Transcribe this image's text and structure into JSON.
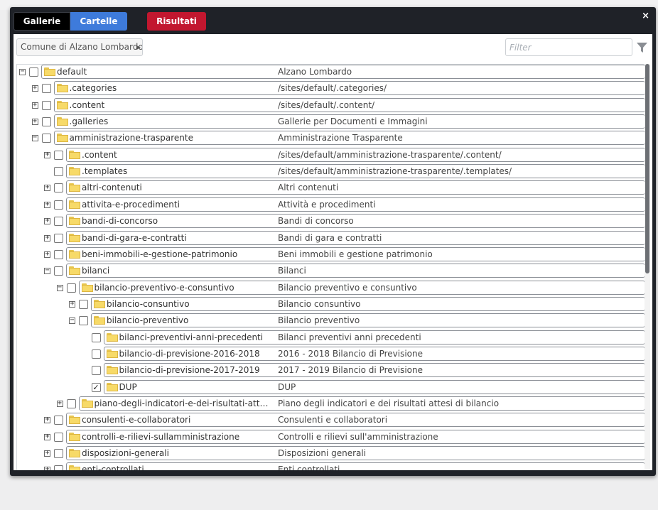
{
  "tabs": {
    "gallerie": "Gallerie",
    "cartelle": "Cartelle",
    "risultati": "Risultati"
  },
  "close_glyph": "×",
  "toolbar": {
    "site_select": "Comune di Alzano Lombardo",
    "filter_placeholder": "Filter",
    "filter_icon": "funnel-icon"
  },
  "colors": {
    "tab_active": "#3e7bdb",
    "tab_results": "#c2172f",
    "folder": "#f7da68"
  },
  "tree": [
    {
      "name": "default",
      "desc": "Alzano Lombardo",
      "level": 0,
      "expander": "minus",
      "checked": false
    },
    {
      "name": ".categories",
      "desc": "/sites/default/.categories/",
      "level": 1,
      "expander": "plus",
      "checked": false
    },
    {
      "name": ".content",
      "desc": "/sites/default/.content/",
      "level": 1,
      "expander": "plus",
      "checked": false
    },
    {
      "name": ".galleries",
      "desc": "Gallerie per Documenti e Immagini",
      "level": 1,
      "expander": "plus",
      "checked": false
    },
    {
      "name": "amministrazione-trasparente",
      "desc": "Amministrazione Trasparente",
      "level": 1,
      "expander": "minus",
      "checked": false
    },
    {
      "name": ".content",
      "desc": "/sites/default/amministrazione-trasparente/.content/",
      "level": 2,
      "expander": "plus",
      "checked": false
    },
    {
      "name": ".templates",
      "desc": "/sites/default/amministrazione-trasparente/.templates/",
      "level": 2,
      "expander": "none",
      "checked": false
    },
    {
      "name": "altri-contenuti",
      "desc": "Altri contenuti",
      "level": 2,
      "expander": "plus",
      "checked": false
    },
    {
      "name": "attivita-e-procedimenti",
      "desc": "Attività e procedimenti",
      "level": 2,
      "expander": "plus",
      "checked": false
    },
    {
      "name": "bandi-di-concorso",
      "desc": "Bandi di concorso",
      "level": 2,
      "expander": "plus",
      "checked": false
    },
    {
      "name": "bandi-di-gara-e-contratti",
      "desc": "Bandi di gara e contratti",
      "level": 2,
      "expander": "plus",
      "checked": false
    },
    {
      "name": "beni-immobili-e-gestione-patrimonio",
      "desc": "Beni immobili e gestione patrimonio",
      "level": 2,
      "expander": "plus",
      "checked": false
    },
    {
      "name": "bilanci",
      "desc": "Bilanci",
      "level": 2,
      "expander": "minus",
      "checked": false
    },
    {
      "name": "bilancio-preventivo-e-consuntivo",
      "desc": "Bilancio preventivo e consuntivo",
      "level": 3,
      "expander": "minus",
      "checked": false
    },
    {
      "name": "bilancio-consuntivo",
      "desc": "Bilancio consuntivo",
      "level": 4,
      "expander": "plus",
      "checked": false
    },
    {
      "name": "bilancio-preventivo",
      "desc": "Bilancio preventivo",
      "level": 4,
      "expander": "minus",
      "checked": false
    },
    {
      "name": "bilanci-preventivi-anni-precedenti",
      "desc": "Bilanci preventivi anni precedenti",
      "level": 5,
      "expander": "none",
      "checked": false
    },
    {
      "name": "bilancio-di-previsione-2016-2018",
      "desc": "2016 - 2018 Bilancio di Previsione",
      "level": 5,
      "expander": "none",
      "checked": false
    },
    {
      "name": "bilancio-di-previsione-2017-2019",
      "desc": "2017 - 2019 Bilancio di Previsione",
      "level": 5,
      "expander": "none",
      "checked": false
    },
    {
      "name": "DUP",
      "desc": "DUP",
      "level": 5,
      "expander": "none",
      "checked": true
    },
    {
      "name": "piano-degli-indicatori-e-dei-risultati-attesi-...",
      "desc": "Piano degli indicatori e dei risultati attesi di bilancio",
      "level": 3,
      "expander": "plus",
      "checked": false
    },
    {
      "name": "consulenti-e-collaboratori",
      "desc": "Consulenti e collaboratori",
      "level": 2,
      "expander": "plus",
      "checked": false
    },
    {
      "name": "controlli-e-rilievi-sullamministrazione",
      "desc": "Controlli e rilievi sull'amministrazione",
      "level": 2,
      "expander": "plus",
      "checked": false
    },
    {
      "name": "disposizioni-generali",
      "desc": "Disposizioni generali",
      "level": 2,
      "expander": "plus",
      "checked": false
    },
    {
      "name": "enti-controllati",
      "desc": "Enti controllati",
      "level": 2,
      "expander": "plus",
      "checked": false
    }
  ]
}
